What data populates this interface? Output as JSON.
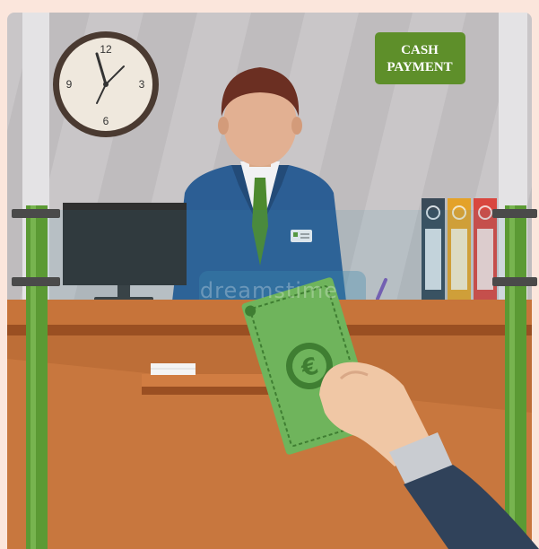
{
  "sign": {
    "line1": "CASH",
    "line2": "PAYMENT"
  },
  "clock": {
    "numerals": [
      "12",
      "3",
      "6",
      "9"
    ]
  },
  "currency_symbol": "€",
  "watermark": "dreamstime",
  "colors": {
    "background": "#fbe6dc",
    "wall": "#c9c6c8",
    "counter": "#c7743a",
    "suit": "#2c5e94",
    "tie": "#4d8a2e",
    "banknote": "#6fb45c",
    "sign": "#5e8f2a",
    "posts": "#5b9a34"
  }
}
